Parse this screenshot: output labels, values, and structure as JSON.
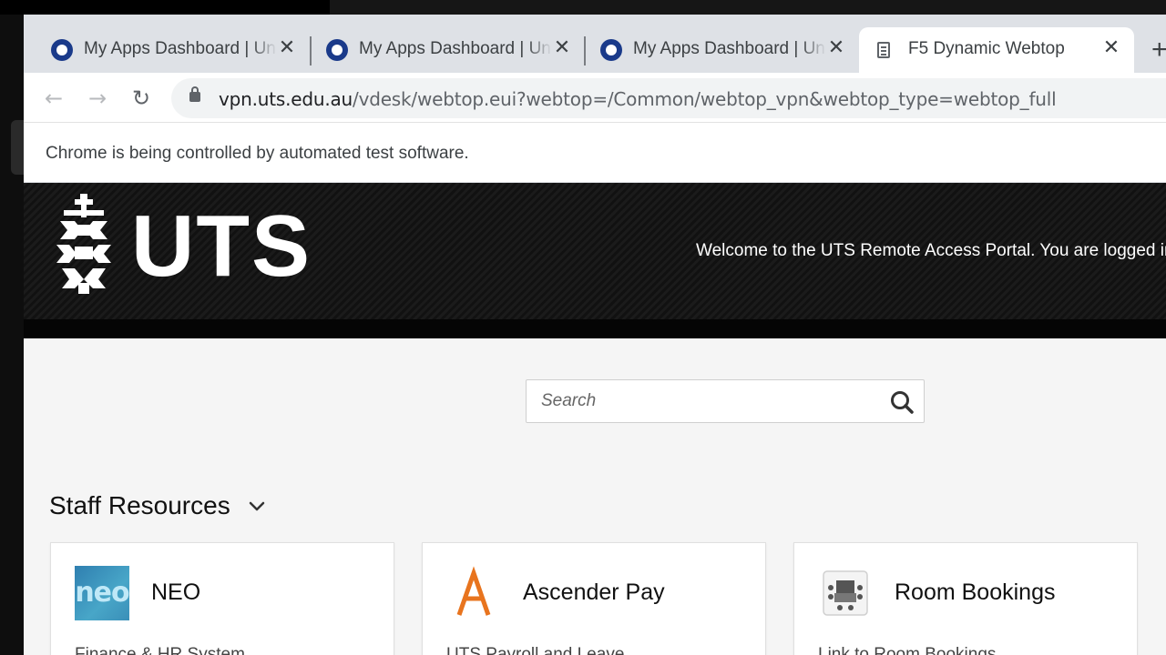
{
  "browser": {
    "tabs": [
      {
        "title": "My Apps Dashboard | University",
        "active": false,
        "favicon": "ring-icon"
      },
      {
        "title": "My Apps Dashboard | University",
        "active": false,
        "favicon": "ring-icon"
      },
      {
        "title": "My Apps Dashboard | University",
        "active": false,
        "favicon": "ring-icon"
      },
      {
        "title": "F5 Dynamic Webtop",
        "active": true,
        "favicon": "document-icon"
      }
    ],
    "tab_close_glyph": "✕",
    "new_tab_glyph": "+",
    "url_host": "vpn.uts.edu.au",
    "url_path": "/vdesk/webtop.eui?webtop=/Common/webtop_vpn&webtop_type=webtop_full",
    "infobar_text": "Chrome is being controlled by automated test software."
  },
  "banner": {
    "logo_text": "UTS",
    "welcome": "Welcome to the UTS Remote Access Portal. You are logged in"
  },
  "search": {
    "placeholder": "Search"
  },
  "section": {
    "title": "Staff Resources"
  },
  "cards": [
    {
      "title": "NEO",
      "description": "Finance & HR System",
      "icon": "neo-logo-icon",
      "icon_text": "neo"
    },
    {
      "title": "Ascender Pay",
      "description": "UTS Payroll and Leave",
      "icon": "ascender-logo-icon"
    },
    {
      "title": "Room Bookings",
      "description": "Link to Room Bookings",
      "icon": "room-bookings-icon"
    }
  ],
  "colors": {
    "tabstrip": "#dee1e6",
    "favicon_blue": "#1a3a8a",
    "banner_dark": "#111111",
    "main_bg": "#f5f5f5",
    "ascender_orange": "#e8741e"
  }
}
